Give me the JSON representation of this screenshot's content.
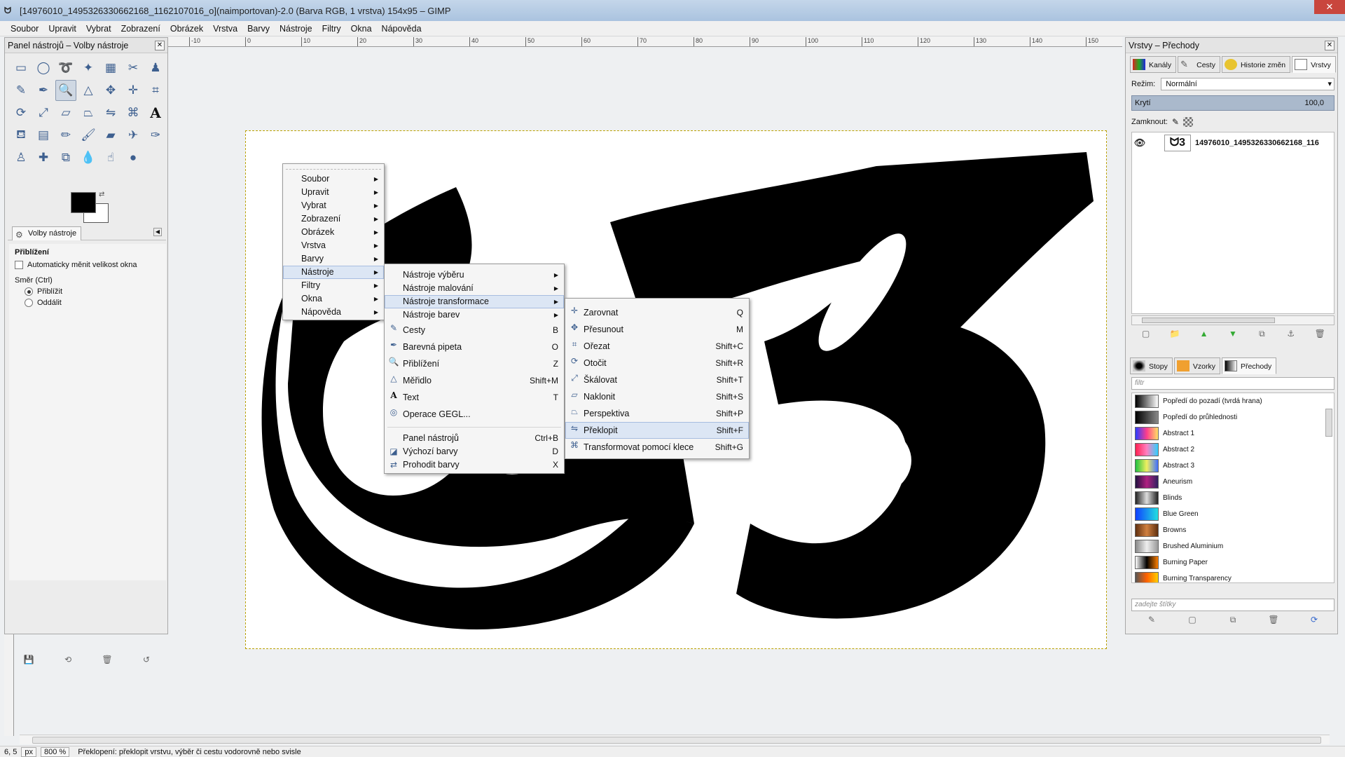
{
  "window": {
    "title": "[14976010_1495326330662168_1162107016_o](naimportovan)-2.0 (Barva RGB, 1 vrstva) 154x95 – GIMP",
    "close_label": "✕"
  },
  "menubar": [
    "Soubor",
    "Upravit",
    "Vybrat",
    "Zobrazení",
    "Obrázek",
    "Vrstva",
    "Barvy",
    "Nástroje",
    "Filtry",
    "Okna",
    "Nápověda"
  ],
  "toolbox": {
    "title": "Panel nástrojů – Volby nástroje",
    "options_tab": "Volby nástroje",
    "options_heading": "Přiblížení",
    "auto_resize": "Automaticky měnit velikost okna",
    "direction_label": "Směr (Ctrl)",
    "zoom_in": "Přiblížit",
    "zoom_out": "Oddálit"
  },
  "main_menu": {
    "items": [
      "Soubor",
      "Upravit",
      "Vybrat",
      "Zobrazení",
      "Obrázek",
      "Vrstva",
      "Barvy",
      "Nástroje",
      "Filtry",
      "Okna",
      "Nápověda"
    ],
    "highlighted": "Nástroje"
  },
  "tools_menu": {
    "items": [
      {
        "label": "Nástroje výběru",
        "sub": true
      },
      {
        "label": "Nástroje malování",
        "sub": true
      },
      {
        "label": "Nástroje transformace",
        "sub": true,
        "hl": true
      },
      {
        "label": "Nástroje barev",
        "sub": true
      },
      {
        "label": "Cesty",
        "shortcut": "B",
        "icon": "paths-icon"
      },
      {
        "label": "Barevná pipeta",
        "shortcut": "O",
        "icon": "color-picker-icon"
      },
      {
        "label": "Přiblížení",
        "shortcut": "Z",
        "icon": "zoom-icon"
      },
      {
        "label": "Měřidlo",
        "shortcut": "Shift+M",
        "icon": "measure-icon"
      },
      {
        "label": "Text",
        "shortcut": "T",
        "icon": "text-icon"
      },
      {
        "label": "Operace GEGL...",
        "icon": "gegl-icon"
      },
      {
        "label": "Panel nástrojů",
        "shortcut": "Ctrl+B",
        "sep_before": true
      },
      {
        "label": "Výchozí barvy",
        "shortcut": "D",
        "icon": "default-colors-icon"
      },
      {
        "label": "Prohodit barvy",
        "shortcut": "X",
        "icon": "swap-colors-icon"
      }
    ]
  },
  "transform_menu": {
    "items": [
      {
        "label": "Zarovnat",
        "shortcut": "Q",
        "icon": "align-icon"
      },
      {
        "label": "Přesunout",
        "shortcut": "M",
        "icon": "move-icon"
      },
      {
        "label": "Ořezat",
        "shortcut": "Shift+C",
        "icon": "crop-icon"
      },
      {
        "label": "Otočit",
        "shortcut": "Shift+R",
        "icon": "rotate-icon"
      },
      {
        "label": "Škálovat",
        "shortcut": "Shift+T",
        "icon": "scale-icon"
      },
      {
        "label": "Naklonit",
        "shortcut": "Shift+S",
        "icon": "shear-icon"
      },
      {
        "label": "Perspektiva",
        "shortcut": "Shift+P",
        "icon": "perspective-icon"
      },
      {
        "label": "Překlopit",
        "shortcut": "Shift+F",
        "icon": "flip-icon",
        "hl": true
      },
      {
        "label": "Transformovat pomocí klece",
        "shortcut": "Shift+G",
        "icon": "cage-icon"
      }
    ]
  },
  "right_dock": {
    "title": "Vrstvy – Přechody",
    "tabs": [
      "Kanály",
      "Cesty",
      "Historie změn",
      "Vrstvy"
    ],
    "mode_label": "Režim:",
    "mode_value": "Normální",
    "opacity_label": "Krytí",
    "opacity_value": "100,0",
    "lock_label": "Zamknout:",
    "layer_name": "14976010_1495326330662168_116",
    "tabs2": [
      "Stopy",
      "Vzorky",
      "Přechody"
    ],
    "filter_placeholder": "filtr",
    "tags_placeholder": "zadejte štítky",
    "gradients": [
      {
        "name": "Popředí do pozadí (tvrdá hrana)",
        "colors": [
          "#000000",
          "#ffffff"
        ]
      },
      {
        "name": "Popředí do průhlednosti",
        "colors": [
          "#000000",
          "#888888"
        ]
      },
      {
        "name": "Abstract 1",
        "colors": [
          "#2a3cff",
          "#ff3d8b",
          "#ffe066"
        ]
      },
      {
        "name": "Abstract 2",
        "colors": [
          "#ff2050",
          "#ff80c0",
          "#30d0ff"
        ]
      },
      {
        "name": "Abstract 3",
        "colors": [
          "#20c040",
          "#f0f060",
          "#4070ff"
        ]
      },
      {
        "name": "Aneurism",
        "colors": [
          "#201040",
          "#b02080",
          "#302060"
        ]
      },
      {
        "name": "Blinds",
        "colors": [
          "#222222",
          "#dddddd",
          "#222222"
        ]
      },
      {
        "name": "Blue Green",
        "colors": [
          "#1040ff",
          "#20e0e0"
        ]
      },
      {
        "name": "Browns",
        "colors": [
          "#603010",
          "#d08040",
          "#603010"
        ]
      },
      {
        "name": "Brushed Aluminium",
        "colors": [
          "#888888",
          "#eeeeee",
          "#999999"
        ]
      },
      {
        "name": "Burning Paper",
        "colors": [
          "#ffffff",
          "#000000",
          "#ff8000"
        ]
      },
      {
        "name": "Burning Transparency",
        "colors": [
          "#555555",
          "#ff6000",
          "#ffd000"
        ]
      }
    ]
  },
  "statusbar": {
    "coords": "6, 5",
    "unit": "px",
    "zoom": "800 %",
    "message": "Překlopení: překlopit vrstvu, výběr či cestu vodorovně nebo svisle"
  },
  "ruler_labels": [
    "-10",
    "0",
    "10",
    "20",
    "30",
    "40",
    "50",
    "60",
    "70",
    "80",
    "90",
    "100",
    "110",
    "120",
    "130",
    "140",
    "150"
  ]
}
